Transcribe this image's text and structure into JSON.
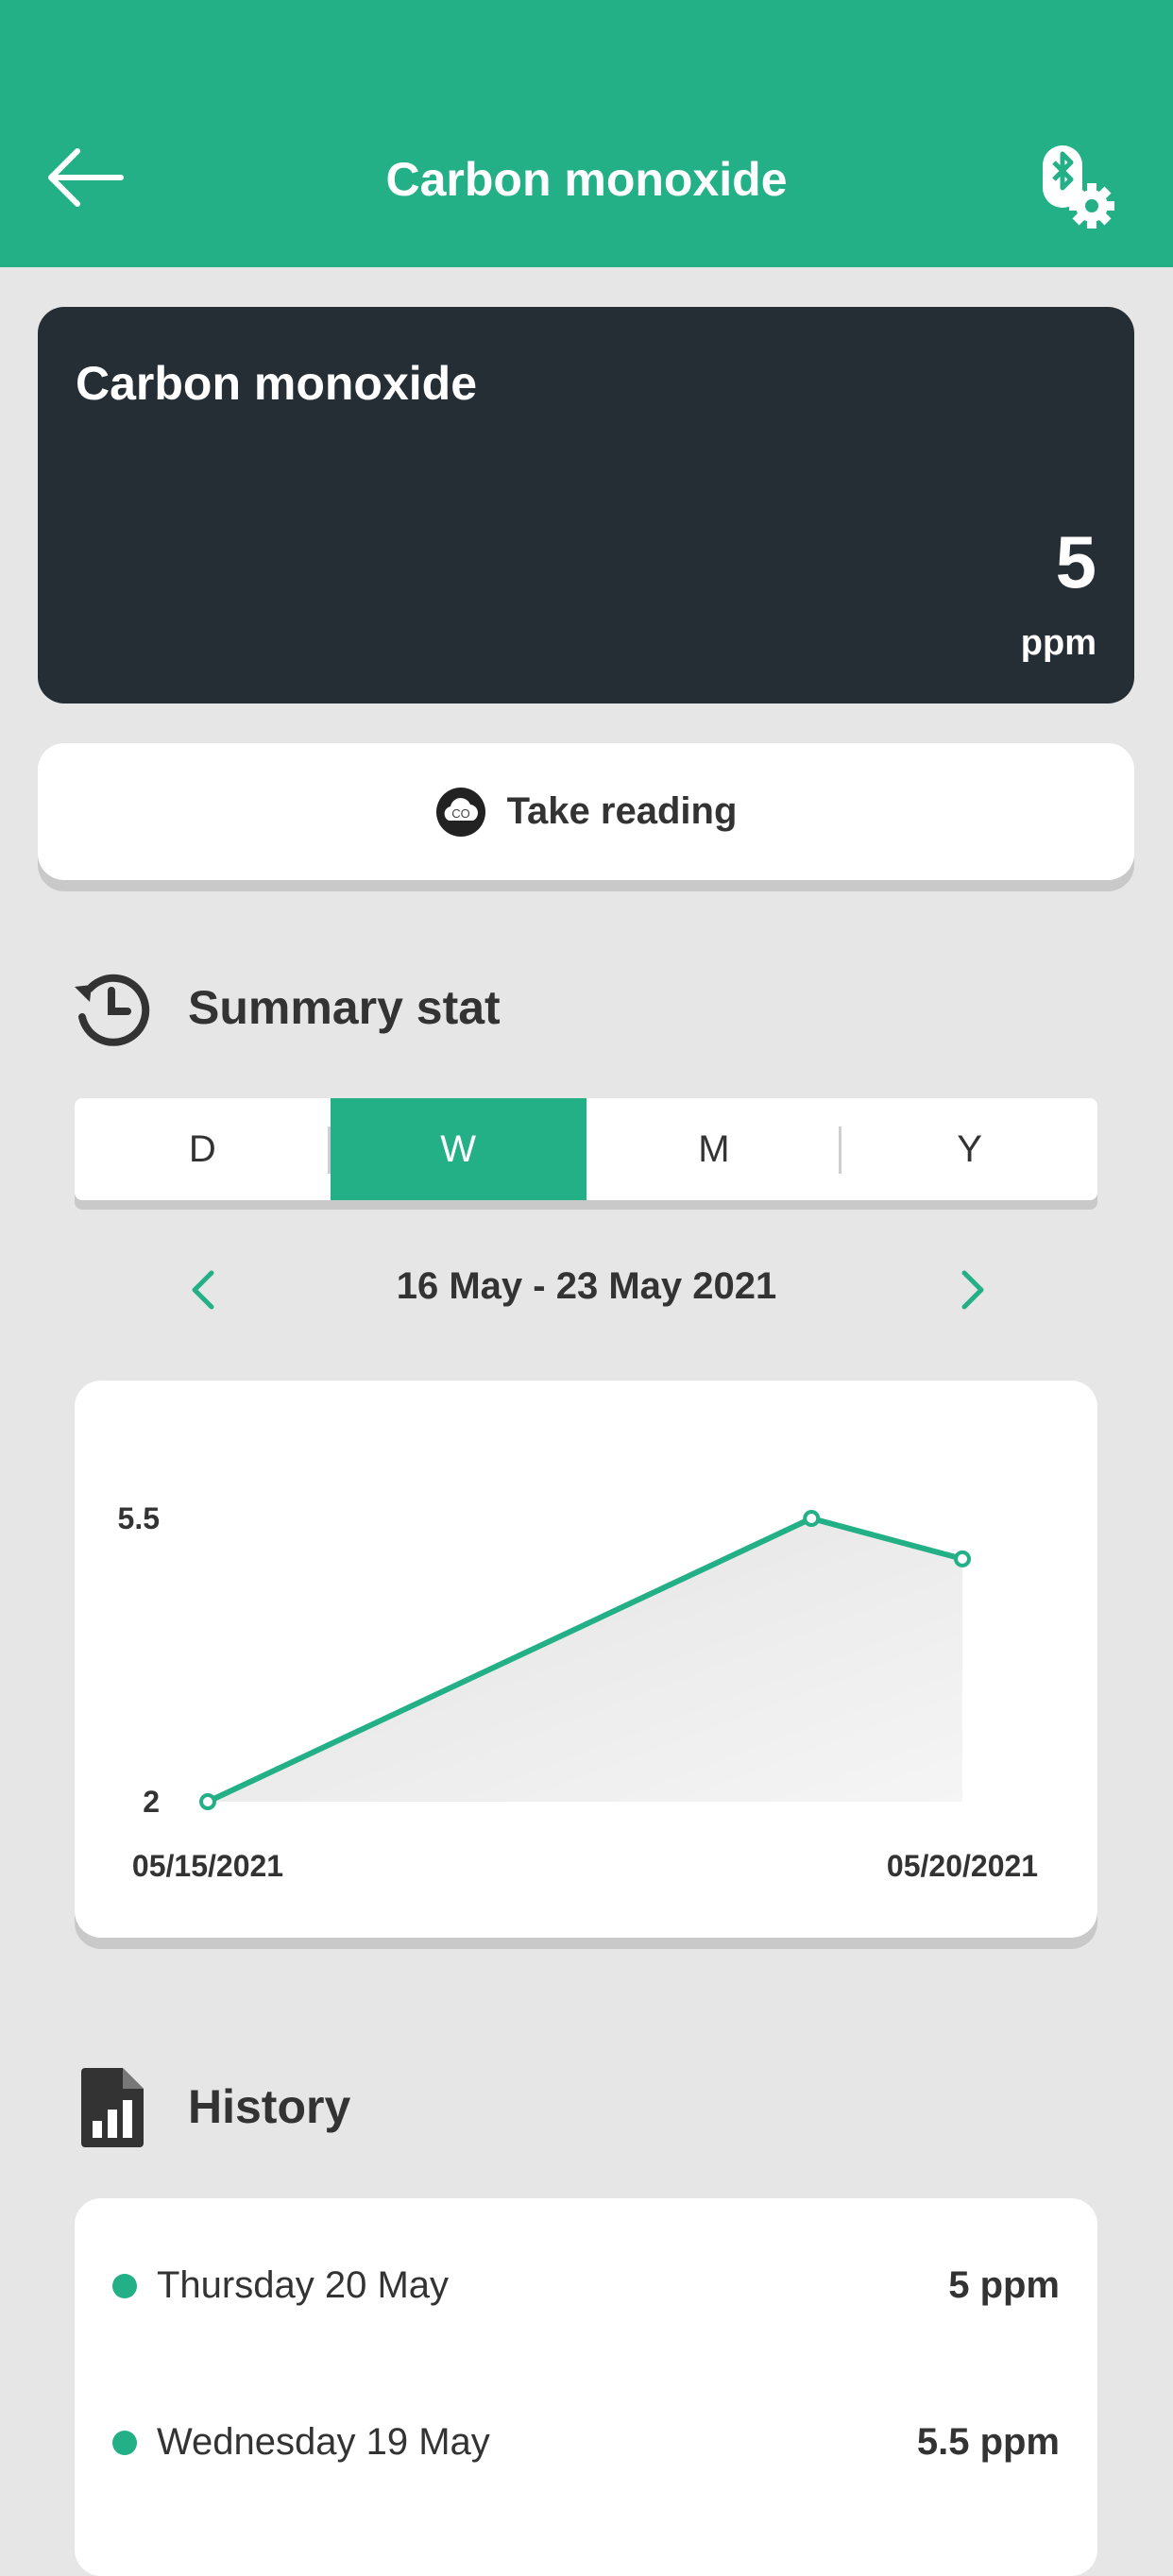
{
  "header": {
    "title": "Carbon monoxide",
    "back_icon": "arrow-left-icon",
    "settings_icon": "bluetooth-settings-icon",
    "color": "#24b086"
  },
  "current": {
    "title": "Carbon monoxide",
    "value": "5",
    "unit": "ppm"
  },
  "take_reading": {
    "label": "Take reading",
    "icon": "co-cloud-icon",
    "icon_text": "CO"
  },
  "summary": {
    "title": "Summary stat",
    "icon": "history-clock-icon",
    "tabs": [
      {
        "label": "D",
        "active": false
      },
      {
        "label": "W",
        "active": true
      },
      {
        "label": "M",
        "active": false
      },
      {
        "label": "Y",
        "active": false
      }
    ],
    "date_range": "16 May - 23 May 2021"
  },
  "chart_data": {
    "type": "area",
    "x": [
      "05/15/2021",
      "05/19/2021",
      "05/20/2021"
    ],
    "values": [
      2,
      5.5,
      5
    ],
    "y_tick_labels": [
      "2",
      "5.5"
    ],
    "x_tick_labels": [
      "05/15/2021",
      "05/20/2021"
    ],
    "ylim": [
      2,
      5.5
    ],
    "line_color": "#24b086",
    "grid": false
  },
  "history": {
    "title": "History",
    "icon": "report-chart-icon",
    "items": [
      {
        "date": "Thursday 20 May",
        "value": "5 ppm"
      },
      {
        "date": "Wednesday 19 May",
        "value": "5.5 ppm"
      }
    ]
  }
}
